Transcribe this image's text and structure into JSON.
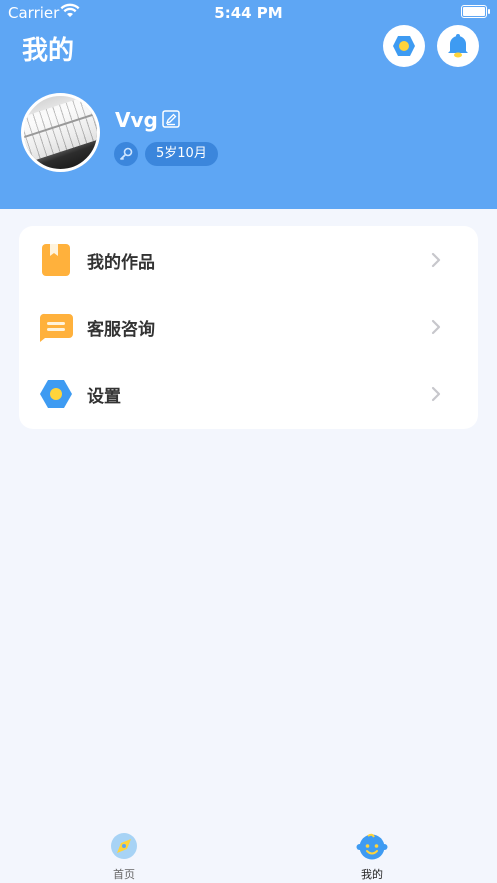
{
  "status_bar": {
    "carrier": "Carrier",
    "time": "5:44 PM"
  },
  "header": {
    "title": "我的",
    "settings_icon": "settings-icon",
    "bell_icon": "bell-icon",
    "background_color": "#5ea6f4"
  },
  "profile": {
    "username": "Vvg",
    "age": "5岁10月",
    "edit_icon": "edit-icon",
    "badge_icon": "key-badge-icon"
  },
  "menu": {
    "items": [
      {
        "label": "我的作品",
        "icon": "bookmark-icon",
        "color": "#ffb13c"
      },
      {
        "label": "客服咨询",
        "icon": "chat-icon",
        "color": "#ffb13c"
      },
      {
        "label": "设置",
        "icon": "settings-icon",
        "color": "#3e9bf2"
      }
    ]
  },
  "tab_bar": {
    "tabs": [
      {
        "label": "首页",
        "icon": "compass-icon",
        "active": false
      },
      {
        "label": "我的",
        "icon": "baby-face-icon",
        "active": true
      }
    ]
  }
}
